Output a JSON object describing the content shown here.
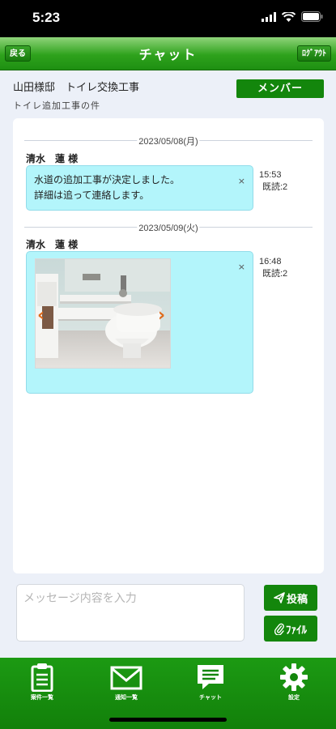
{
  "status_bar": {
    "time": "5:23"
  },
  "nav": {
    "back_label": "戻る",
    "title": "チャット",
    "logout_label": "ﾛｸﾞｱｳﾄ"
  },
  "project": {
    "title": "山田様邸　トイレ交換工事",
    "subtitle": "トイレ追加工事の件",
    "member_label": "メンバー"
  },
  "messages": [
    {
      "date": "2023/05/08(月)",
      "sender": "清水　蓮 様",
      "lines": [
        "水道の追加工事が決定しました。",
        "詳細は追って連絡します。"
      ],
      "time": "15:53",
      "read": "既読:2",
      "close": "×"
    },
    {
      "date": "2023/05/09(火)",
      "sender": "清水　蓮 様",
      "attachment": "toilet-photo",
      "time": "16:48",
      "read": "既読:2",
      "close": "×",
      "prev_arrow": "‹",
      "next_arrow": "›"
    }
  ],
  "composer": {
    "placeholder": "メッセージ内容を入力",
    "post_label": "投稿",
    "file_label": "ﾌｧｲﾙ"
  },
  "tabs": [
    {
      "label": "案件一覧",
      "icon": "clipboard-icon"
    },
    {
      "label": "通知一覧",
      "icon": "envelope-icon"
    },
    {
      "label": "チャット",
      "icon": "chat-icon"
    },
    {
      "label": "設定",
      "icon": "gear-icon"
    }
  ],
  "colors": {
    "header_green": "#2ea21c",
    "button_green": "#13860c",
    "bubble": "#b3f5fb",
    "background": "#ecf0f8"
  }
}
